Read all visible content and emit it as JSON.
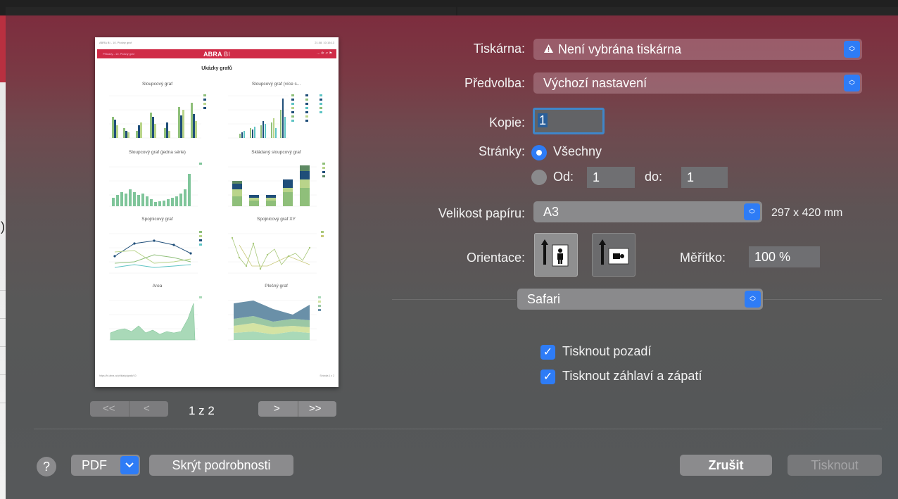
{
  "preview": {
    "top_left": "ABRA BI - 10. Plošný graf",
    "top_right": "21.08. 10:15:13",
    "brand": "ABRA",
    "brand_suffix": "BI",
    "crumb": "Příklady - 10. Plošný graf",
    "header_icons": "… ⟳ ↗ ⚑",
    "title": "Ukázky grafů",
    "charts": [
      {
        "title": "Sloupcový graf"
      },
      {
        "title": "Sloupcový graf (více s..."
      },
      {
        "title": "Sloupcový graf (jedna série)"
      },
      {
        "title": "Skládaný sloupcový graf"
      },
      {
        "title": "Spojnicový graf"
      },
      {
        "title": "Spojnicový graf XY"
      },
      {
        "title": "Area"
      },
      {
        "title": "Plošný graf"
      }
    ],
    "footer_left": "https://bi.abra.cz/příklady/grafy/10",
    "footer_right": "Stránka 1 z 2"
  },
  "pager": {
    "first": "<<",
    "prev": "<",
    "next": ">",
    "last": ">>",
    "page_label": "1 z 2"
  },
  "form": {
    "printer_label": "Tiskárna:",
    "printer_value": "Není vybrána tiskárna",
    "printer_warning_icon": "warning-icon",
    "preset_label": "Předvolba:",
    "preset_value": "Výchozí nastavení",
    "copies_label": "Kopie:",
    "copies_value": "1",
    "pages_label": "Stránky:",
    "pages_all_label": "Všechny",
    "pages_from_label": "Od:",
    "pages_from_value": "1",
    "pages_to_label": "do:",
    "pages_to_value": "1",
    "paper_label": "Velikost papíru:",
    "paper_value": "A3",
    "paper_dims": "297 x 420 mm",
    "orientation_label": "Orientace:",
    "scale_label": "Měřítko:",
    "scale_value": "100 %",
    "app_value": "Safari",
    "print_backgrounds": "Tisknout pozadí",
    "print_headers": "Tisknout záhlaví a zápatí"
  },
  "bottom": {
    "help": "?",
    "pdf": "PDF",
    "hide_details": "Skrýt podrobnosti",
    "cancel": "Zrušit",
    "print": "Tisknout"
  },
  "colors": {
    "accent": "#2e7cf6",
    "abra_red": "#d02b47"
  }
}
